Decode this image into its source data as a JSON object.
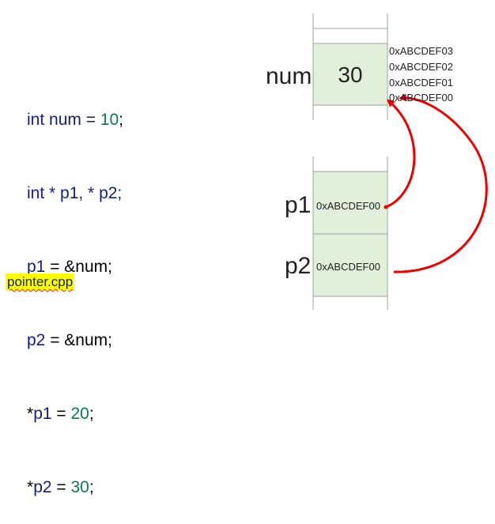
{
  "code": {
    "line1": {
      "kw": "int",
      "rest": " num = ",
      "val": "10",
      "end": ";"
    },
    "line2": {
      "kw": "int",
      "rest": " * p1, * p2;"
    },
    "line3": {
      "id": "p1",
      "rest": " = &num;"
    },
    "line4": {
      "id": "p2",
      "rest": " = &num;"
    },
    "line5": {
      "star": "*",
      "id": "p1",
      "rest": " = ",
      "val": "20",
      "end": ";"
    },
    "line6": {
      "star": "*",
      "id": "p2",
      "rest": " = ",
      "val": "30",
      "end": ";"
    }
  },
  "file_name": "pointer.cpp",
  "memory": {
    "num": {
      "label": "num",
      "value": "30"
    },
    "addresses": [
      "0xABCDEF03",
      "0xABCDEF02",
      "0xABCDEF01",
      "0xABCDEF00"
    ],
    "p1": {
      "label": "p1",
      "value": "0xABCDEF00"
    },
    "p2": {
      "label": "p2",
      "value": "0xABCDEF00"
    }
  },
  "colors": {
    "cell_fill": "#e2efda",
    "cell_border": "#9aa4a0",
    "arrow": "#ee0000",
    "keyword": "#1a1aa6",
    "number": "#0a7a55",
    "highlight": "#ffff00"
  }
}
